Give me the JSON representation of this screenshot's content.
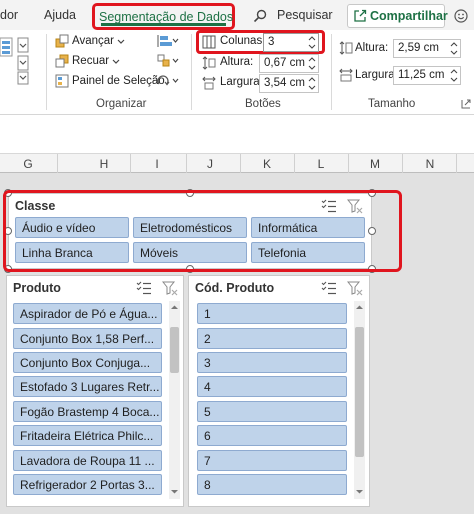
{
  "menu": {
    "items": [
      "dor",
      "Ajuda"
    ],
    "active_tab": "Segmentação de Dados",
    "search_label": "Pesquisar",
    "share_label": "Compartilhar",
    "active_tab_color": "#1e7145"
  },
  "ribbon": {
    "organizar": {
      "label": "Organizar",
      "avancar": "Avançar",
      "recuar": "Recuar",
      "painel": "Painel de Seleção"
    },
    "botoes": {
      "label": "Botões",
      "colunas_label": "Colunas:",
      "colunas_value": "3",
      "altura_label": "Altura:",
      "altura_value": "0,67 cm",
      "largura_label": "Largura:",
      "largura_value": "3,54 cm"
    },
    "tamanho": {
      "label": "Tamanho",
      "altura_label": "Altura:",
      "altura_value": "2,59 cm",
      "largura_label": "Largura:",
      "largura_value": "11,25 cm"
    }
  },
  "sheet": {
    "columns": [
      "G",
      "H",
      "I",
      "J",
      "K",
      "L",
      "M",
      "N"
    ]
  },
  "slicers": {
    "classe": {
      "title": "Classe",
      "items": [
        "Áudio e vídeo",
        "Eletrodomésticos",
        "Informática",
        "Linha Branca",
        "Móveis",
        "Telefonia"
      ]
    },
    "produto": {
      "title": "Produto",
      "items": [
        "Aspirador de Pó e Água...",
        "Conjunto Box 1,58 Perf...",
        "Conjunto Box Conjuga...",
        "Estofado 3 Lugares Retr...",
        "Fogão Brastemp 4 Boca...",
        "Fritadeira Elétrica Philc...",
        "Lavadora de Roupa 11 ...",
        "Refrigerador 2 Portas 3..."
      ]
    },
    "codigo": {
      "title": "Cód. Produto",
      "items": [
        "1",
        "2",
        "3",
        "4",
        "5",
        "6",
        "7",
        "8"
      ]
    }
  },
  "colors": {
    "highlight": "#e0151e",
    "slicer_button": "#bfd3ea",
    "slicer_border": "#8eaad0"
  }
}
